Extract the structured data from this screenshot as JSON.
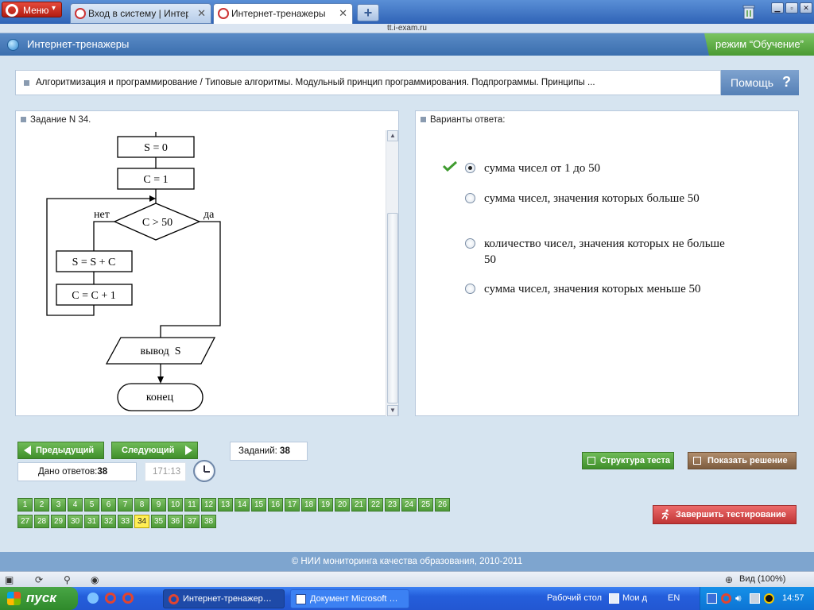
{
  "browser": {
    "menu_label": "Меню",
    "tabs": [
      {
        "title": "Вход в систему | Интер…"
      },
      {
        "title": "Интернет-тренажеры"
      }
    ],
    "url": "tt.i-exam.ru",
    "zoom": "Вид (100%)"
  },
  "app": {
    "title": "Интернет-тренажеры",
    "mode": "режим “Обучение”",
    "topic": "Алгоритмизация и программирование / Типовые алгоритмы. Модульный принцип программирования. Подпрограммы. Принципы ...",
    "help_label": "Помощь",
    "help_glyph": "?"
  },
  "task": {
    "header": "Задание N 34.",
    "flowchart": {
      "s_init": "S = 0",
      "c_init": "C = 1",
      "condition": "C > 50",
      "no_label": "нет",
      "yes_label": "да",
      "s_update": "S = S + C",
      "c_update": "C = C + 1",
      "output": "вывод  S",
      "end": "конец"
    }
  },
  "answers": {
    "header": "Варианты ответа:",
    "selected_index": 0,
    "options": [
      {
        "text": "сумма чисел от 1 до 50",
        "correct": true
      },
      {
        "text": "сумма чисел, значения которых больше 50"
      },
      {
        "text": "количество чисел, значения которых не больше 50"
      },
      {
        "text": "сумма чисел, значения которых меньше 50"
      }
    ]
  },
  "controls": {
    "prev_label": "Предыдущий",
    "next_label": "Следующий",
    "tasks_label": "Заданий:",
    "tasks_total": "38",
    "answered_label": "Дано ответов:",
    "answered_count": "38",
    "timer": "171:13",
    "structure_label": "Структура теста",
    "solution_label": "Показать решение",
    "finish_label": "Завершить тестирование",
    "current_task": 34,
    "task_numbers": [
      "1",
      "2",
      "3",
      "4",
      "5",
      "6",
      "7",
      "8",
      "9",
      "10",
      "11",
      "12",
      "13",
      "14",
      "15",
      "16",
      "17",
      "18",
      "19",
      "20",
      "21",
      "22",
      "23",
      "24",
      "25",
      "26",
      "27",
      "28",
      "29",
      "30",
      "31",
      "32",
      "33",
      "34",
      "35",
      "36",
      "37",
      "38"
    ]
  },
  "footer": "© НИИ мониторинга качества образования, 2010-2011",
  "taskbar": {
    "start_label": "пуск",
    "items": [
      {
        "label": "Интернет-тренажер…"
      },
      {
        "label": "Документ Microsoft …"
      }
    ],
    "desktop_label": "Рабочий стол",
    "my_label": "Мои д",
    "lang": "EN",
    "time": "14:57"
  },
  "colors": {
    "accent_green": "#4a9a33",
    "header_blue": "#3b6fae",
    "finish_red": "#c03535",
    "current_task_yellow": "#ffee55"
  }
}
